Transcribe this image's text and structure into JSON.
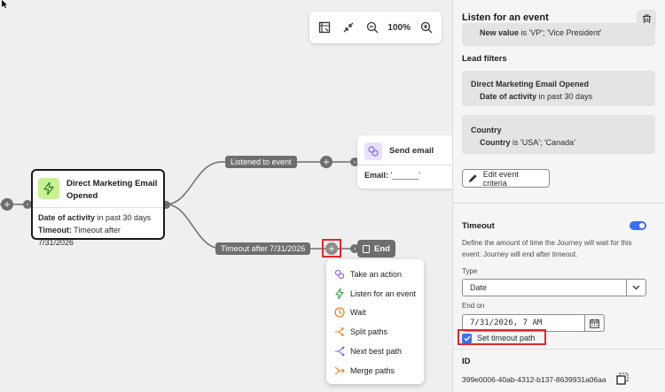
{
  "canvas": {
    "toolbar": {
      "zoom_label": "100%",
      "icons": [
        "fit-to-screen-icon",
        "collapse-icon",
        "zoom-out-icon",
        "zoom-in-icon"
      ]
    },
    "nodes": {
      "main": {
        "title": "Direct Marketing Email Opened",
        "condition_key": "Date of activity",
        "condition_value": " in past 30 days",
        "timeout_key": "Timeout:",
        "timeout_value": " Timeout after 7/31/2026"
      },
      "email": {
        "title": "Send email",
        "field_key": "Email:",
        "field_value": " '______'"
      },
      "end": {
        "label": "End"
      }
    },
    "paths": {
      "listened": "Listened to event",
      "timeout": "Timeout after 7/31/2026"
    },
    "menu": [
      {
        "label": "Take an action",
        "icon": "action-icon",
        "color": "#8a5df0"
      },
      {
        "label": "Listen for an event",
        "icon": "lightning-icon",
        "color": "#39a84a"
      },
      {
        "label": "Wait",
        "icon": "clock-icon",
        "color": "#e87b12"
      },
      {
        "label": "Split paths",
        "icon": "split-icon",
        "color": "#e87b12"
      },
      {
        "label": "Next best path",
        "icon": "next-best-icon",
        "color": "#8a5df0"
      },
      {
        "label": "Merge paths",
        "icon": "merge-icon",
        "color": "#e87b12"
      }
    ]
  },
  "panel": {
    "title": "Listen for an event",
    "partial_filter": {
      "key": "New value",
      "value": " is 'VP'; 'Vice President'"
    },
    "lead_filters_title": "Lead filters",
    "lead_filters": [
      {
        "title": "Direct Marketing Email Opened",
        "key": "Date of activity",
        "value": " in past 30 days"
      },
      {
        "title": "Country",
        "key": "Country",
        "value": " is 'USA'; 'Canada'"
      }
    ],
    "edit_button": "Edit event criteria",
    "timeout": {
      "title": "Timeout",
      "enabled": true,
      "description": "Define the amount of time the Journey will wait for this event. Journey will end after timeout.",
      "type_label": "Type",
      "type_value": "Date",
      "end_on_label": "End on",
      "end_on_value": "7/31/2026, 7 AM",
      "set_timeout_path_label": "Set timeout path",
      "set_timeout_path_checked": true
    },
    "id_label": "ID",
    "id_value": "399e0006-40ab-4312-b137-8639931a06aa"
  },
  "colors": {
    "accent_blue": "#3b6ff0",
    "highlight_red": "#e3262b",
    "connector_gray": "#6e6e6e",
    "event_green": "#c7f291"
  }
}
